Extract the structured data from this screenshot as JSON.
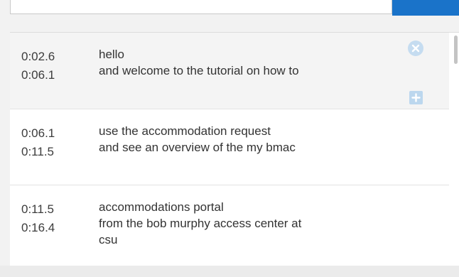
{
  "top_controls": {
    "input_value": "",
    "button_color": "#1a73c9"
  },
  "cues": [
    {
      "start": "0:02.6",
      "end": "0:06.1",
      "lines": [
        "hello",
        "and welcome to the tutorial on how to"
      ],
      "active": true
    },
    {
      "start": "0:06.1",
      "end": "0:11.5",
      "lines": [
        "use the accommodation request",
        "and see an overview of the my bmac"
      ],
      "active": false
    },
    {
      "start": "0:11.5",
      "end": "0:16.4",
      "lines": [
        "accommodations portal",
        "from the bob murphy access center at",
        "csu"
      ],
      "active": false
    }
  ],
  "icons": {
    "remove": "close-circle-icon",
    "add": "plus-square-icon"
  },
  "colors": {
    "accent": "#1a73c9",
    "icon_light_blue": "#bcd7ee"
  }
}
